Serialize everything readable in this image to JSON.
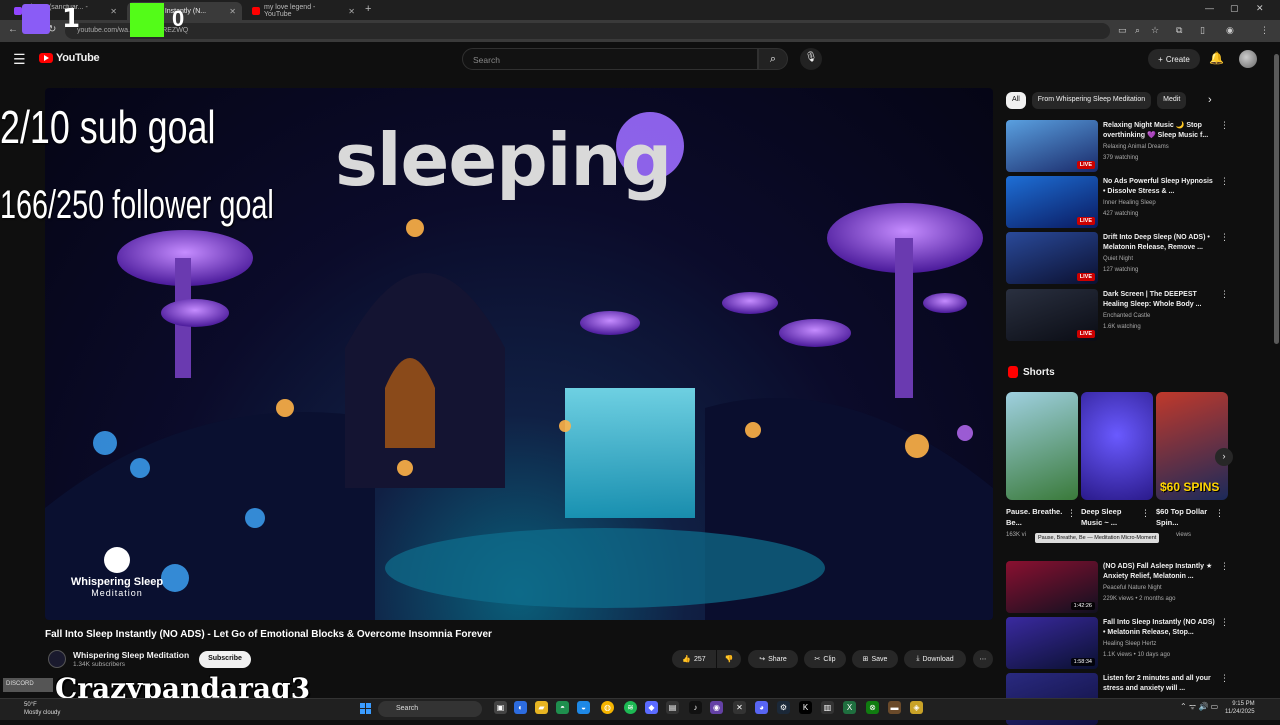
{
  "browser": {
    "tabs": [
      {
        "label": "Alyeus (sanctuar... - Twitch",
        "color": "#9146ff"
      },
      {
        "label": "Sleep Instantly (N...",
        "color": "#ff0000"
      },
      {
        "label": "my love legend - YouTube",
        "color": "#ff0000"
      }
    ],
    "url": "youtube.com/wa...      ...MBNDREZWQ"
  },
  "overlay": {
    "count_left": "1",
    "count_right": "0",
    "sub_goal": "2/10 sub goal",
    "follower_goal": "166/250 follower goal",
    "streamer_name": "Crazypandarag3",
    "discord_label": "DISCORD"
  },
  "youtube": {
    "logo_text": "YouTube",
    "search_placeholder": "Search",
    "create_label": "Create"
  },
  "video": {
    "overlay_text": "sleeping",
    "watermark_line1": "Whispering Sleep",
    "watermark_line2": "Meditation",
    "title": "Fall Into Sleep Instantly (NO ADS) - Let Go of Emotional Blocks & Overcome Insomnia Forever",
    "channel": "Whispering Sleep Meditation",
    "subscribers": "1.34K subscribers",
    "subscribe_label": "Subscribe",
    "likes": "257",
    "share_label": "Share",
    "clip_label": "Clip",
    "save_label": "Save",
    "download_label": "Download"
  },
  "sidebar": {
    "chips": [
      "All",
      "From Whispering Sleep Meditation",
      "Medit"
    ],
    "recs_top": [
      {
        "title": "Relaxing Night Music 🌙 Stop overthinking 💜 Sleep Music f...",
        "channel": "Relaxing Animal Dreams",
        "meta": "379 watching",
        "badge": "LIVE",
        "colors": [
          "#5aa0e0",
          "#1a2a6a"
        ]
      },
      {
        "title": "No Ads Powerful Sleep Hypnosis • Dissolve Stress & ...",
        "channel": "Inner Healing Sleep",
        "meta": "427 watching",
        "badge": "LIVE",
        "colors": [
          "#1e6fd6",
          "#0a1a60"
        ]
      },
      {
        "title": "Drift Into Deep Sleep (NO ADS) • Melatonin Release, Remove ...",
        "channel": "Quiet Night",
        "meta": "127 watching",
        "badge": "LIVE",
        "colors": [
          "#2a4a9a",
          "#0b1030"
        ]
      },
      {
        "title": "Dark Screen | The DEEPEST Healing Sleep: Whole Body ...",
        "channel": "Enchanted Castle",
        "meta": "1.6K watching",
        "badge": "LIVE",
        "colors": [
          "#2a3040",
          "#0a0c14"
        ]
      }
    ],
    "shorts_header": "Shorts",
    "shorts": [
      {
        "title": "Pause. Breathe. Be...",
        "views": "163K vi",
        "colors": [
          "#3a7a3a",
          "#9fd0e0"
        ]
      },
      {
        "title": "Deep Sleep Music ~ ...",
        "views": "",
        "colors": [
          "#2a1a8a",
          "#6a5aff"
        ]
      },
      {
        "title": "$60 Top Dollar Spin...",
        "views": "views",
        "colors": [
          "#c0392b",
          "#1b2a5a"
        ],
        "badge": "$60 SPINS"
      }
    ],
    "tooltip": "Pause, Breathe, Be — Meditation Micro-Moment",
    "recs_bottom": [
      {
        "title": "(NO ADS) Fall Asleep Instantly ★ Anxiety Relief, Melatonin ...",
        "channel": "Peaceful Nature Night",
        "meta": "229K views • 2 months ago",
        "badge": "1:42:26",
        "colors": [
          "#8a1030",
          "#101020"
        ]
      },
      {
        "title": "Fall Into Sleep Instantly (NO ADS) • Melatonin Release, Stop...",
        "channel": "Healing Sleep Hertz",
        "meta": "1.1K views • 10 days ago",
        "badge": "1:58:34",
        "colors": [
          "#3a2aa0",
          "#0a1030"
        ]
      },
      {
        "title": "Listen for 2 minutes and all your stress and anxiety will ...",
        "channel": "",
        "meta": "",
        "badge": "",
        "colors": [
          "#2a2a80",
          "#101040"
        ]
      }
    ]
  },
  "taskbar": {
    "weather_temp": "50°F",
    "weather_desc": "Mostly cloudy",
    "search_label": "Search",
    "time": "9:15 PM",
    "date": "11/24/2025"
  }
}
